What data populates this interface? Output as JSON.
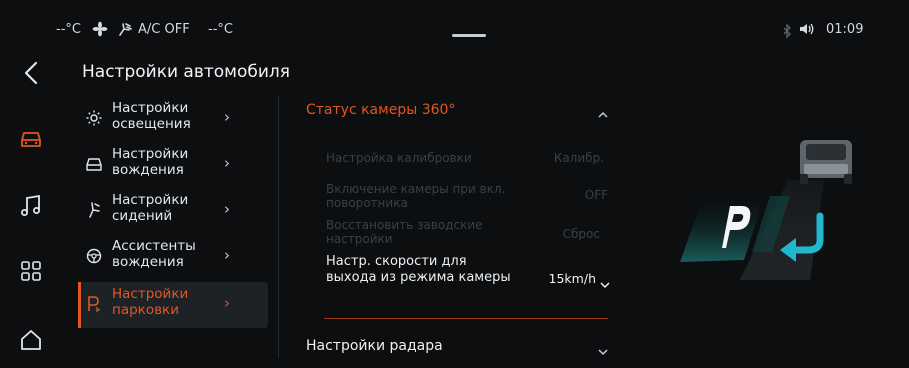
{
  "status_bar": {
    "left_temp": "--°C",
    "ac_label": "A/C OFF",
    "right_temp": "--°C",
    "time": "01:09"
  },
  "page_title": "Настройки автомобиля",
  "menu": [
    {
      "label": "Настройки освещения",
      "icon": "sun-icon",
      "active": false
    },
    {
      "label": "Настройки вождения",
      "icon": "car-icon",
      "active": false
    },
    {
      "label": "Настройки сидений",
      "icon": "seat-icon",
      "active": false
    },
    {
      "label": "Ассистенты вождения",
      "icon": "steering-wheel-icon",
      "active": false
    },
    {
      "label": "Настройки парковки",
      "icon": "parking-icon",
      "active": true
    }
  ],
  "camera_section": {
    "title": "Статус камеры 360°",
    "rows": [
      {
        "label": "Настройка калибровки",
        "value": "Калибр.",
        "enabled": false
      },
      {
        "label": "Включение камеры при вкл. поворотника",
        "value": "OFF",
        "enabled": false
      },
      {
        "label": "Восстановить заводские настройки",
        "value": "Сброс",
        "enabled": false
      },
      {
        "label": "Настр. скорости для выхода из режима камеры",
        "value": "15km/h",
        "enabled": true
      }
    ]
  },
  "radar_section": {
    "title": "Настройки радара"
  },
  "colors": {
    "accent": "#e2571f",
    "background": "#0c0e10",
    "disabled_text": "#394047"
  }
}
